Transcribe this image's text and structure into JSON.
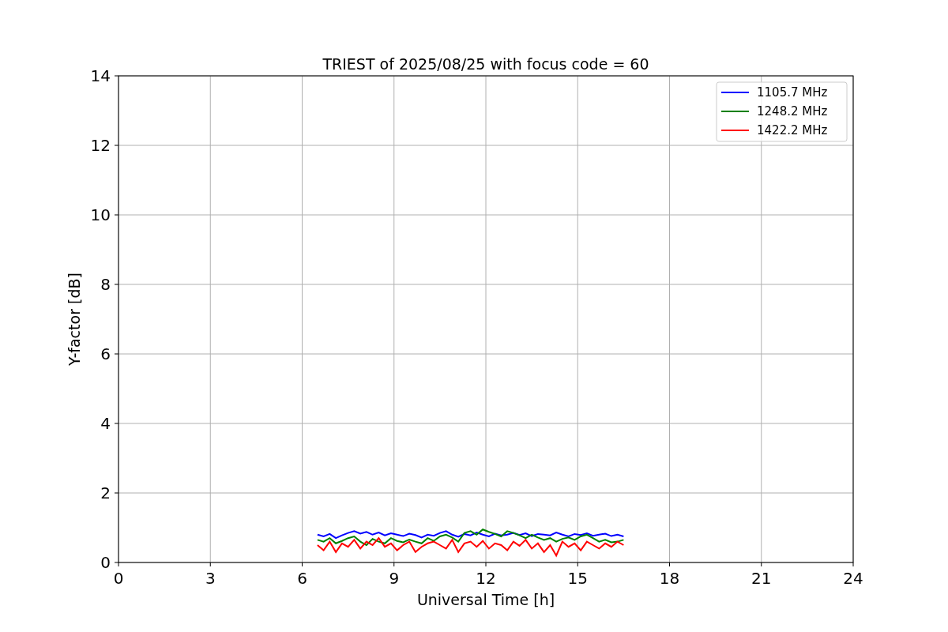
{
  "chart_data": {
    "type": "line",
    "title": "TRIEST of 2025/08/25 with focus code = 60",
    "xlabel": "Universal Time [h]",
    "ylabel": "Y-factor [dB]",
    "x": [
      6.5,
      6.7,
      6.9,
      7.1,
      7.3,
      7.5,
      7.7,
      7.9,
      8.1,
      8.3,
      8.5,
      8.7,
      8.9,
      9.1,
      9.3,
      9.5,
      9.7,
      9.9,
      10.1,
      10.3,
      10.5,
      10.7,
      10.9,
      11.1,
      11.3,
      11.5,
      11.7,
      11.9,
      12.1,
      12.3,
      12.5,
      12.7,
      12.9,
      13.1,
      13.3,
      13.5,
      13.7,
      13.9,
      14.1,
      14.3,
      14.5,
      14.7,
      14.9,
      15.1,
      15.3,
      15.5,
      15.7,
      15.9,
      16.1,
      16.3,
      16.5
    ],
    "series": [
      {
        "name": "1105.7 MHz",
        "color": "#0000ff",
        "values": [
          0.8,
          0.75,
          0.82,
          0.7,
          0.78,
          0.85,
          0.9,
          0.83,
          0.88,
          0.8,
          0.86,
          0.78,
          0.84,
          0.8,
          0.76,
          0.83,
          0.79,
          0.72,
          0.8,
          0.77,
          0.85,
          0.9,
          0.8,
          0.74,
          0.82,
          0.78,
          0.86,
          0.8,
          0.75,
          0.83,
          0.78,
          0.8,
          0.85,
          0.79,
          0.84,
          0.76,
          0.82,
          0.8,
          0.78,
          0.86,
          0.8,
          0.75,
          0.82,
          0.79,
          0.84,
          0.77,
          0.8,
          0.83,
          0.76,
          0.8,
          0.75
        ]
      },
      {
        "name": "1248.2 MHz",
        "color": "#008000",
        "values": [
          0.65,
          0.6,
          0.7,
          0.55,
          0.62,
          0.7,
          0.75,
          0.6,
          0.5,
          0.68,
          0.6,
          0.55,
          0.7,
          0.62,
          0.58,
          0.66,
          0.6,
          0.55,
          0.7,
          0.62,
          0.75,
          0.8,
          0.72,
          0.6,
          0.85,
          0.9,
          0.8,
          0.95,
          0.88,
          0.82,
          0.75,
          0.9,
          0.85,
          0.78,
          0.7,
          0.8,
          0.72,
          0.65,
          0.7,
          0.6,
          0.68,
          0.72,
          0.65,
          0.75,
          0.8,
          0.7,
          0.6,
          0.65,
          0.58,
          0.6,
          0.65
        ]
      },
      {
        "name": "1422.2 MHz",
        "color": "#ff0000",
        "values": [
          0.5,
          0.35,
          0.6,
          0.3,
          0.55,
          0.45,
          0.65,
          0.4,
          0.6,
          0.5,
          0.7,
          0.45,
          0.55,
          0.35,
          0.5,
          0.6,
          0.3,
          0.45,
          0.55,
          0.6,
          0.5,
          0.4,
          0.65,
          0.3,
          0.55,
          0.6,
          0.45,
          0.62,
          0.4,
          0.55,
          0.5,
          0.35,
          0.6,
          0.48,
          0.65,
          0.4,
          0.55,
          0.3,
          0.5,
          0.2,
          0.6,
          0.45,
          0.55,
          0.35,
          0.6,
          0.5,
          0.4,
          0.55,
          0.45,
          0.6,
          0.5
        ]
      }
    ],
    "xlim": [
      0,
      24
    ],
    "ylim": [
      0,
      14
    ],
    "xticks": [
      0,
      3,
      6,
      9,
      12,
      15,
      18,
      21,
      24
    ],
    "yticks": [
      0,
      2,
      4,
      6,
      8,
      10,
      12,
      14
    ],
    "grid": true,
    "legend": true
  }
}
